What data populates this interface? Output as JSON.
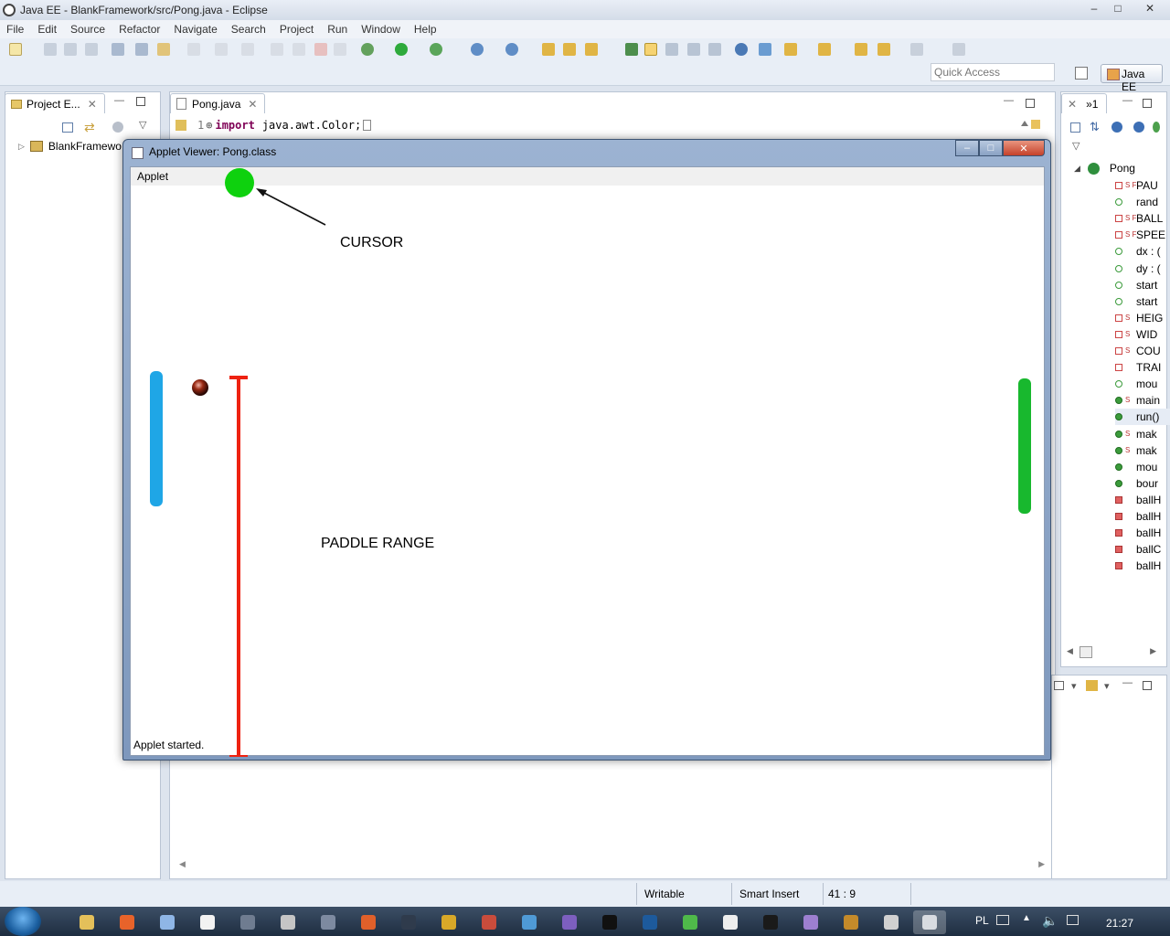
{
  "window": {
    "title": "Java EE - BlankFramework/src/Pong.java - Eclipse"
  },
  "menu": [
    "File",
    "Edit",
    "Source",
    "Refactor",
    "Navigate",
    "Search",
    "Project",
    "Run",
    "Window",
    "Help"
  ],
  "toolbar": {
    "quick_access_placeholder": "Quick Access",
    "perspective_label": "Java EE"
  },
  "project_explorer": {
    "tab_label": "Project E...",
    "tree_item": "BlankFramewo"
  },
  "editor": {
    "tab_label": "Pong.java",
    "line_number": "1",
    "code_keyword": "import",
    "code_text": "java.awt.Color;"
  },
  "outline": {
    "tab_label": "»1",
    "root": "Pong",
    "items": [
      {
        "label": "PAU",
        "kind": "static-final"
      },
      {
        "label": "rand",
        "kind": "field"
      },
      {
        "label": "BALL",
        "kind": "static-final"
      },
      {
        "label": "SPEE",
        "kind": "static-final"
      },
      {
        "label": "dx : (",
        "kind": "field"
      },
      {
        "label": "dy : (",
        "kind": "field"
      },
      {
        "label": "start",
        "kind": "field"
      },
      {
        "label": "start",
        "kind": "field"
      },
      {
        "label": "HEIG",
        "kind": "static-private"
      },
      {
        "label": "WID",
        "kind": "static-private"
      },
      {
        "label": "COU",
        "kind": "static-private"
      },
      {
        "label": "TRAI",
        "kind": "private"
      },
      {
        "label": "mou",
        "kind": "field"
      },
      {
        "label": "main",
        "kind": "static-method"
      },
      {
        "label": "run()",
        "kind": "method"
      },
      {
        "label": "mak",
        "kind": "static-method"
      },
      {
        "label": "mak",
        "kind": "static-method"
      },
      {
        "label": "mou",
        "kind": "method"
      },
      {
        "label": "bour",
        "kind": "method"
      },
      {
        "label": "ballH",
        "kind": "private-method"
      },
      {
        "label": "ballH",
        "kind": "private-method"
      },
      {
        "label": "ballH",
        "kind": "private-method"
      },
      {
        "label": "ballC",
        "kind": "private-method"
      },
      {
        "label": "ballH",
        "kind": "private-method"
      }
    ]
  },
  "applet": {
    "title": "Applet Viewer: Pong.class",
    "menu_label": "Applet",
    "status": "Applet started.",
    "annotations": {
      "cursor": "CURSOR",
      "paddle_range": "PADDLE RANGE"
    }
  },
  "statusbar": {
    "writable": "Writable",
    "insert_mode": "Smart Insert",
    "position": "41 : 9"
  },
  "taskbar": {
    "language": "PL",
    "clock": "21:27"
  },
  "colors": {
    "left_paddle": "#1fa6e6",
    "right_paddle": "#18b82e",
    "cursor_dot": "#0ed10e",
    "range_line": "#ee2211"
  }
}
